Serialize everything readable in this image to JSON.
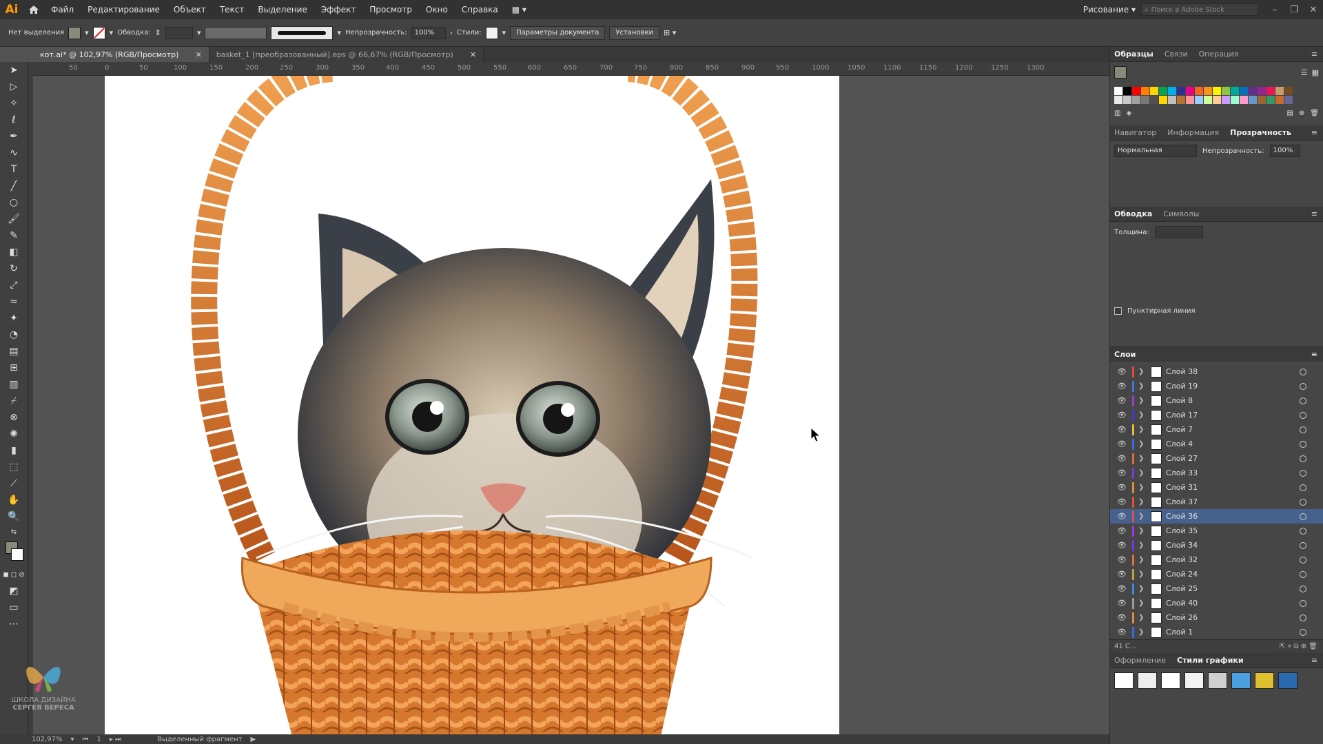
{
  "app": {
    "logo": "Ai",
    "workspace": "Рисование",
    "search_placeholder": "Поиск в Adobe Stock"
  },
  "menu": [
    "Файл",
    "Редактирование",
    "Объект",
    "Текст",
    "Выделение",
    "Эффект",
    "Просмотр",
    "Окно",
    "Справка"
  ],
  "control_bar": {
    "selection_label": "Нет выделения",
    "stroke_label": "Обводка:",
    "opacity_label": "Непрозрачность:",
    "opacity_value": "100%",
    "styles_label": "Стили:",
    "doc_params_button": "Параметры документа",
    "prefs_button": "Установки",
    "fill_color": "#8a8a7a"
  },
  "tabs": [
    {
      "label": "кот.ai* @ 102,97% (RGB/Просмотр)",
      "active": true
    },
    {
      "label": "basket_1 [преобразованный].eps @ 66,67% (RGB/Просмотр)",
      "active": false
    }
  ],
  "ruler_ticks": [
    "50",
    "0",
    "50",
    "100",
    "150",
    "200",
    "250",
    "300",
    "350",
    "400",
    "450",
    "500",
    "550",
    "600",
    "650",
    "700",
    "750",
    "800",
    "850",
    "900",
    "950",
    "1000",
    "1050",
    "1100",
    "1150",
    "1200",
    "1250",
    "1300"
  ],
  "status": {
    "zoom": "102,97%",
    "artboard": "1",
    "selection_text": "Выделенный фрагмент"
  },
  "watermark": {
    "line1": "ШКОЛА ДИЗАЙНА",
    "line2": "СЕРГЕЯ ВЕРЕСА"
  },
  "panels": {
    "top_tabs": [
      "Образцы",
      "Связи",
      "Операция"
    ],
    "middle_tabs": [
      "Навигатор",
      "Информация",
      "Прозрачность"
    ],
    "blend_mode": "Нормальная",
    "transparency_opacity_label": "Непрозрачность:",
    "transparency_opacity_value": "100%",
    "stroke_tabs": [
      "Обводка",
      "Символы"
    ],
    "thickness_label": "Толщина:",
    "dashed_label": "Пунктирная линия",
    "layers_title": "Слои",
    "layers_count": "41 С...",
    "bottom_tabs": [
      "Оформление",
      "Стили графики"
    ]
  },
  "layers": [
    {
      "name": "Слой 38",
      "color": "#e04a3a",
      "selected": false
    },
    {
      "name": "Слой 19",
      "color": "#4a6ee0",
      "selected": false
    },
    {
      "name": "Слой 8",
      "color": "#9a3ad0",
      "selected": false
    },
    {
      "name": "Слой 17",
      "color": "#3a3ae0",
      "selected": false
    },
    {
      "name": "Слой 7",
      "color": "#e0c03a",
      "selected": false
    },
    {
      "name": "Слой 4",
      "color": "#3a6ae0",
      "selected": false
    },
    {
      "name": "Слой 27",
      "color": "#e06a3a",
      "selected": false
    },
    {
      "name": "Слой 33",
      "color": "#7a3ae0",
      "selected": false
    },
    {
      "name": "Слой 31",
      "color": "#e0903a",
      "selected": false
    },
    {
      "name": "Слой 37",
      "color": "#e0503a",
      "selected": false
    },
    {
      "name": "Слой 36",
      "color": "#e05050",
      "selected": true
    },
    {
      "name": "Слой 35",
      "color": "#a03ae0",
      "selected": false
    },
    {
      "name": "Слой 34",
      "color": "#6a3ae0",
      "selected": false
    },
    {
      "name": "Слой 32",
      "color": "#e0703a",
      "selected": false
    },
    {
      "name": "Слой 24",
      "color": "#c0a03a",
      "selected": false
    },
    {
      "name": "Слой 25",
      "color": "#3a8ae0",
      "selected": false
    },
    {
      "name": "Слой 40",
      "color": "#9a9a9a",
      "selected": false
    },
    {
      "name": "Слой 26",
      "color": "#e08a3a",
      "selected": false
    },
    {
      "name": "Слой 1",
      "color": "#3a6ae0",
      "selected": false
    }
  ],
  "swatch_colors": [
    "#ffffff",
    "#000000",
    "#ff0000",
    "#ff7f00",
    "#ffd400",
    "#00a651",
    "#00aeef",
    "#2e3192",
    "#ec008c",
    "#f26522",
    "#f7941d",
    "#fff200",
    "#8dc63f",
    "#00a99d",
    "#0072bc",
    "#662d91",
    "#92278f",
    "#ed145b",
    "#c69c6d",
    "#754c24",
    "#e8e8e8",
    "#c8c8c8",
    "#a0a0a0",
    "#787878",
    "#505050",
    "#ffd700",
    "#c0c0c0",
    "#b87333",
    "#ff9999",
    "#99ccff",
    "#ccff99",
    "#ffcc99",
    "#cc99ff",
    "#99ffcc",
    "#ff99cc",
    "#6699cc",
    "#996633",
    "#339966",
    "#cc6633",
    "#666699"
  ]
}
